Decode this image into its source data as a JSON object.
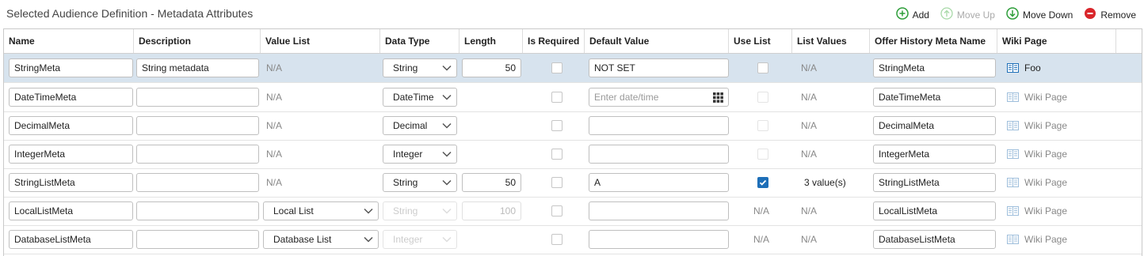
{
  "title": "Selected Audience Definition - Metadata Attributes",
  "toolbar": {
    "add": "Add",
    "move_up": "Move Up",
    "move_down": "Move Down",
    "remove": "Remove"
  },
  "columns": [
    "Name",
    "Description",
    "Value List",
    "Data Type",
    "Length",
    "Is Required",
    "Default Value",
    "Use List",
    "List Values",
    "Offer History Meta Name",
    "Wiki Page"
  ],
  "rows": [
    {
      "name": "StringMeta",
      "description": "String metadata",
      "value_list": "N/A",
      "data_type": "String",
      "length": "50",
      "default_value": "NOT SET",
      "list_values": "N/A",
      "offer_meta": "StringMeta",
      "wiki": "Foo"
    },
    {
      "name": "DateTimeMeta",
      "description": "",
      "value_list": "N/A",
      "data_type": "DateTime",
      "length": "",
      "default_placeholder": "Enter date/time",
      "list_values": "N/A",
      "offer_meta": "DateTimeMeta",
      "wiki": "Wiki Page"
    },
    {
      "name": "DecimalMeta",
      "description": "",
      "value_list": "N/A",
      "data_type": "Decimal",
      "length": "",
      "default_value": "",
      "list_values": "N/A",
      "offer_meta": "DecimalMeta",
      "wiki": "Wiki Page"
    },
    {
      "name": "IntegerMeta",
      "description": "",
      "value_list": "N/A",
      "data_type": "Integer",
      "length": "",
      "default_value": "",
      "list_values": "N/A",
      "offer_meta": "IntegerMeta",
      "wiki": "Wiki Page"
    },
    {
      "name": "StringListMeta",
      "description": "",
      "value_list": "N/A",
      "data_type": "String",
      "length": "50",
      "default_value": "A",
      "list_values": "3 value(s)",
      "offer_meta": "StringListMeta",
      "wiki": "Wiki Page"
    },
    {
      "name": "LocalListMeta",
      "description": "",
      "value_list": "Local List",
      "data_type": "String",
      "length": "100",
      "default_value": "",
      "use_list": "N/A",
      "list_values": "N/A",
      "offer_meta": "LocalListMeta",
      "wiki": "Wiki Page"
    },
    {
      "name": "DatabaseListMeta",
      "description": "",
      "value_list": "Database List",
      "data_type": "Integer",
      "length": "",
      "default_value": "",
      "use_list": "N/A",
      "list_values": "N/A",
      "offer_meta": "DatabaseListMeta",
      "wiki": "Wiki Page"
    }
  ],
  "colors": {
    "selected_row": "#d7e3ee",
    "add": "#2e9e3a",
    "move_up": "#a8d9a8",
    "move_down": "#2e9e3a",
    "remove": "#d9262b",
    "checkbox_checked": "#1e6fb8",
    "wiki_icon": "#1e6fb8"
  }
}
